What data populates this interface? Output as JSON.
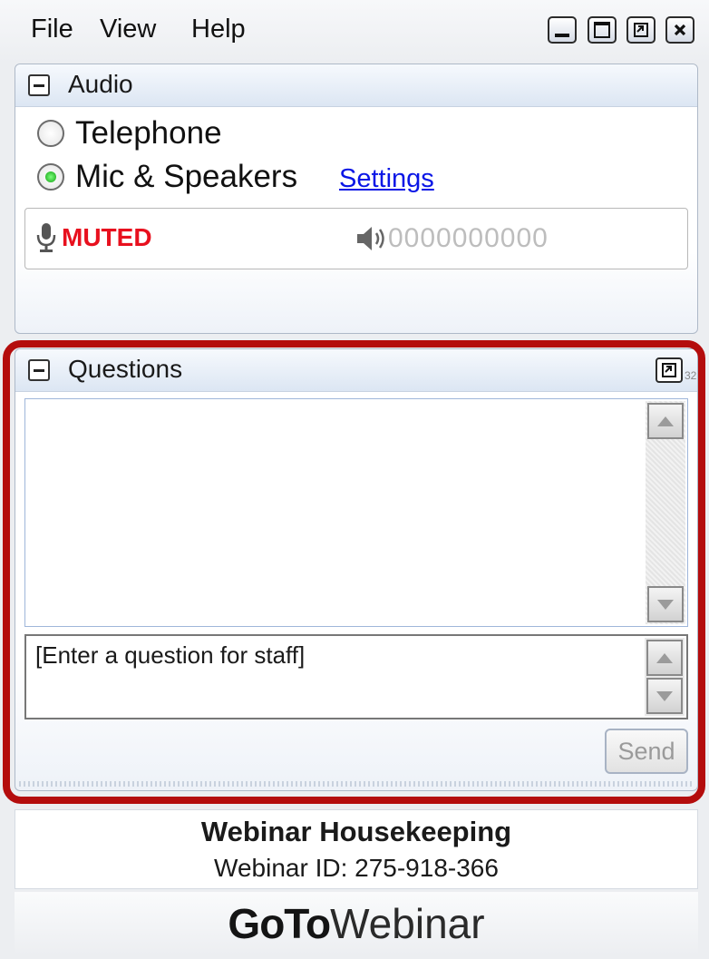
{
  "menu": {
    "file": "File",
    "view": "View",
    "help": "Help"
  },
  "window_controls": {
    "minimize": "minimize-icon",
    "maximize": "maximize-icon",
    "restore": "restore-icon",
    "close": "close-icon"
  },
  "audio": {
    "title": "Audio",
    "telephone_label": "Telephone",
    "mic_label": "Mic & Speakers",
    "selected": "Mic & Speakers",
    "settings_link": "Settings",
    "mic_status": "MUTED",
    "speaker_level": "0000000000",
    "muted_color": "#e8101e"
  },
  "questions": {
    "title": "Questions",
    "side_number": "32",
    "input_placeholder": "[Enter a question for staff]",
    "send_label": "Send",
    "highlight_color": "#b40d0d"
  },
  "footer": {
    "webinar_title": "Webinar Housekeeping",
    "webinar_id": "Webinar ID: 275-918-366",
    "brand_bold": "GoTo",
    "brand_light": "Webinar"
  }
}
